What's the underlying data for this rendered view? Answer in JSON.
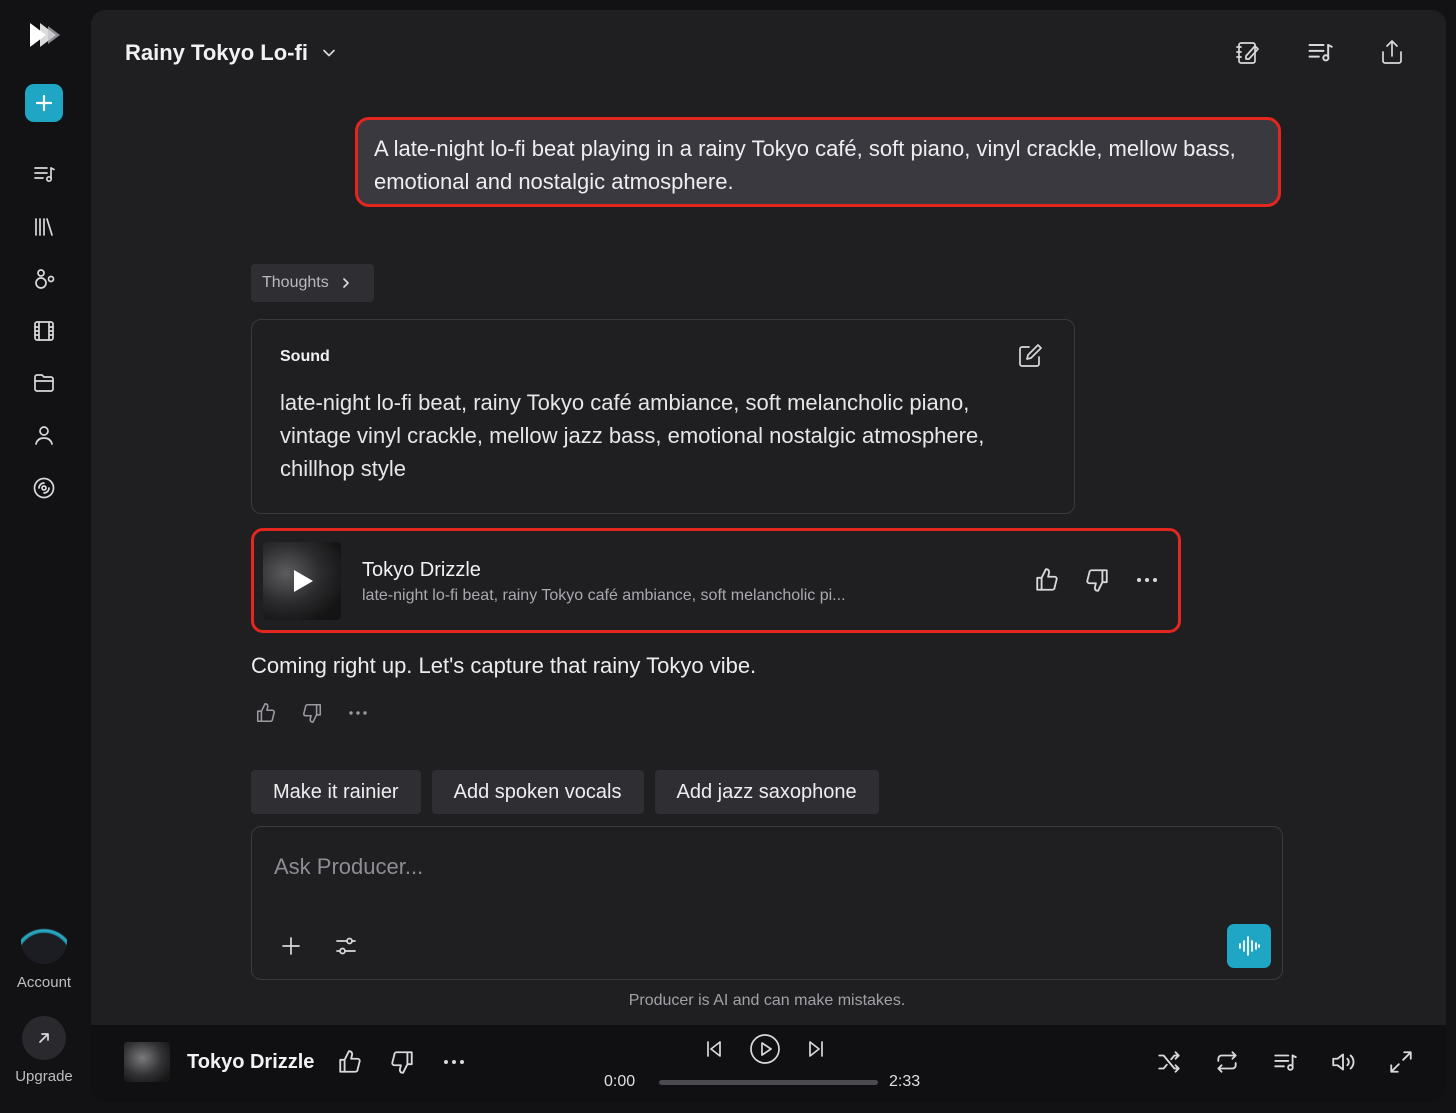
{
  "app": {
    "accent_color": "#1ea6c4",
    "highlight_color": "#e3261f"
  },
  "sidebar": {
    "logo_icon": "play-logo-icon",
    "new_button_icon": "plus-icon",
    "items": [
      {
        "name": "queue",
        "icon": "queue-music-icon"
      },
      {
        "name": "library",
        "icon": "library-icon"
      },
      {
        "name": "community",
        "icon": "community-icon"
      },
      {
        "name": "video",
        "icon": "film-icon"
      },
      {
        "name": "folders",
        "icon": "folder-icon"
      },
      {
        "name": "profile",
        "icon": "person-icon"
      },
      {
        "name": "radio",
        "icon": "disc-icon"
      }
    ],
    "account_label": "Account",
    "upgrade_label": "Upgrade"
  },
  "header": {
    "title": "Rainy Tokyo Lo-fi",
    "actions": [
      "notes-edit-icon",
      "queue-music-icon",
      "share-icon"
    ]
  },
  "chat": {
    "user_prompt": "A late-night lo-fi beat playing in a rainy Tokyo café, soft piano, vinyl crackle, mellow bass, emotional and nostalgic atmosphere.",
    "thoughts_label": "Thoughts",
    "sound_card": {
      "label": "Sound",
      "text": "late-night lo-fi beat, rainy Tokyo café ambiance, soft melancholic piano, vintage vinyl crackle, mellow jazz bass, emotional nostalgic atmosphere, chillhop style"
    },
    "track": {
      "title": "Tokyo Drizzle",
      "subtitle": "late-night lo-fi beat, rainy Tokyo café ambiance, soft melancholic pi..."
    },
    "reply": "Coming right up. Let's capture that rainy Tokyo vibe.",
    "suggestions": [
      "Make it rainier",
      "Add spoken vocals",
      "Add jazz saxophone"
    ]
  },
  "composer": {
    "placeholder": "Ask Producer...",
    "value": ""
  },
  "disclaimer": "Producer is AI and can make mistakes.",
  "player": {
    "title": "Tokyo Drizzle",
    "current_time": "0:00",
    "total_time": "2:33",
    "progress": 0
  }
}
